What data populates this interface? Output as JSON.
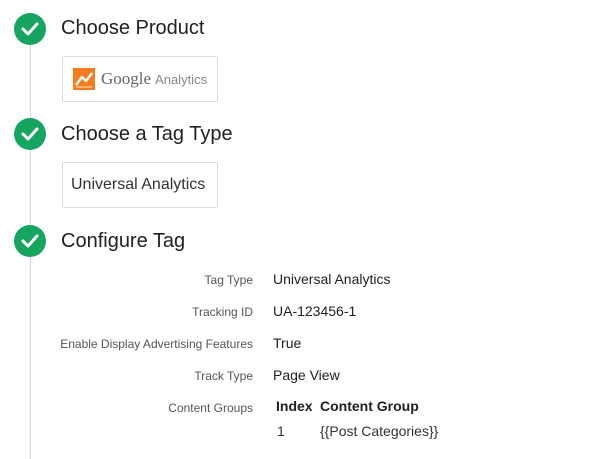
{
  "colors": {
    "check": "#16a561",
    "line": "#d6d6d6"
  },
  "steps": [
    {
      "title": "Choose Product",
      "icon": "check-icon"
    },
    {
      "title": "Choose a Tag Type",
      "icon": "check-icon"
    },
    {
      "title": "Configure Tag",
      "icon": "check-icon"
    }
  ],
  "product_card": {
    "logo_icon": "google-analytics-logo",
    "brand": "Google",
    "product": "Analytics"
  },
  "tag_type_card": {
    "label": "Universal Analytics"
  },
  "config": {
    "rows": [
      {
        "label": "Tag Type",
        "value": "Universal Analytics"
      },
      {
        "label": "Tracking ID",
        "value": "UA-123456-1"
      },
      {
        "label": "Enable Display Advertising Features",
        "value": "True"
      },
      {
        "label": "Track Type",
        "value": "Page View"
      }
    ],
    "content_groups": {
      "label": "Content Groups",
      "headers": [
        "Index",
        "Content Group"
      ],
      "rows": [
        [
          "1",
          "{{Post Categories}}"
        ]
      ]
    }
  }
}
